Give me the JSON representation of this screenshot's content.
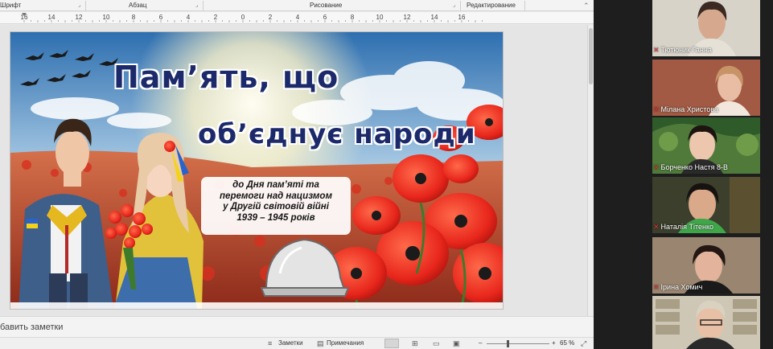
{
  "ribbon": {
    "groups": [
      "Шрифт",
      "Абзац",
      "Рисование",
      "Редактирование"
    ]
  },
  "ruler": {
    "labels": [
      "16",
      "14",
      "12",
      "10",
      "8",
      "6",
      "4",
      "2",
      "0",
      "2",
      "4",
      "6",
      "8",
      "10",
      "12",
      "14",
      "16"
    ]
  },
  "slide": {
    "title_line1": "Пам’ять, що",
    "title_line2": "об’єднує народи",
    "subtitle_lines": [
      "до Дня пам’яті та",
      "перемоги над нацизмом",
      "у Другій світовій війні",
      "1939 – 1945 років"
    ]
  },
  "notes": {
    "placeholder": "бавить заметки"
  },
  "status_bar": {
    "notes_button": "Заметки",
    "comments_button": "Примечания",
    "zoom_minus": "–",
    "zoom_plus": "+",
    "zoom_level": "65 %",
    "zoom_fraction": 0.65
  },
  "participants": [
    {
      "name": "Тютюник Ганна",
      "muted": true
    },
    {
      "name": "Мілана Христова",
      "muted": true
    },
    {
      "name": "Борченко Настя 8-В",
      "muted": true
    },
    {
      "name": "Наталія Тітенко",
      "muted": true
    },
    {
      "name": "Ірина Хомич",
      "muted": true
    },
    {
      "name": "",
      "muted": false
    }
  ],
  "colors": {
    "title": "#1c2a6b",
    "poppy": "#e8261c",
    "mic_off": "#e03a3a"
  }
}
